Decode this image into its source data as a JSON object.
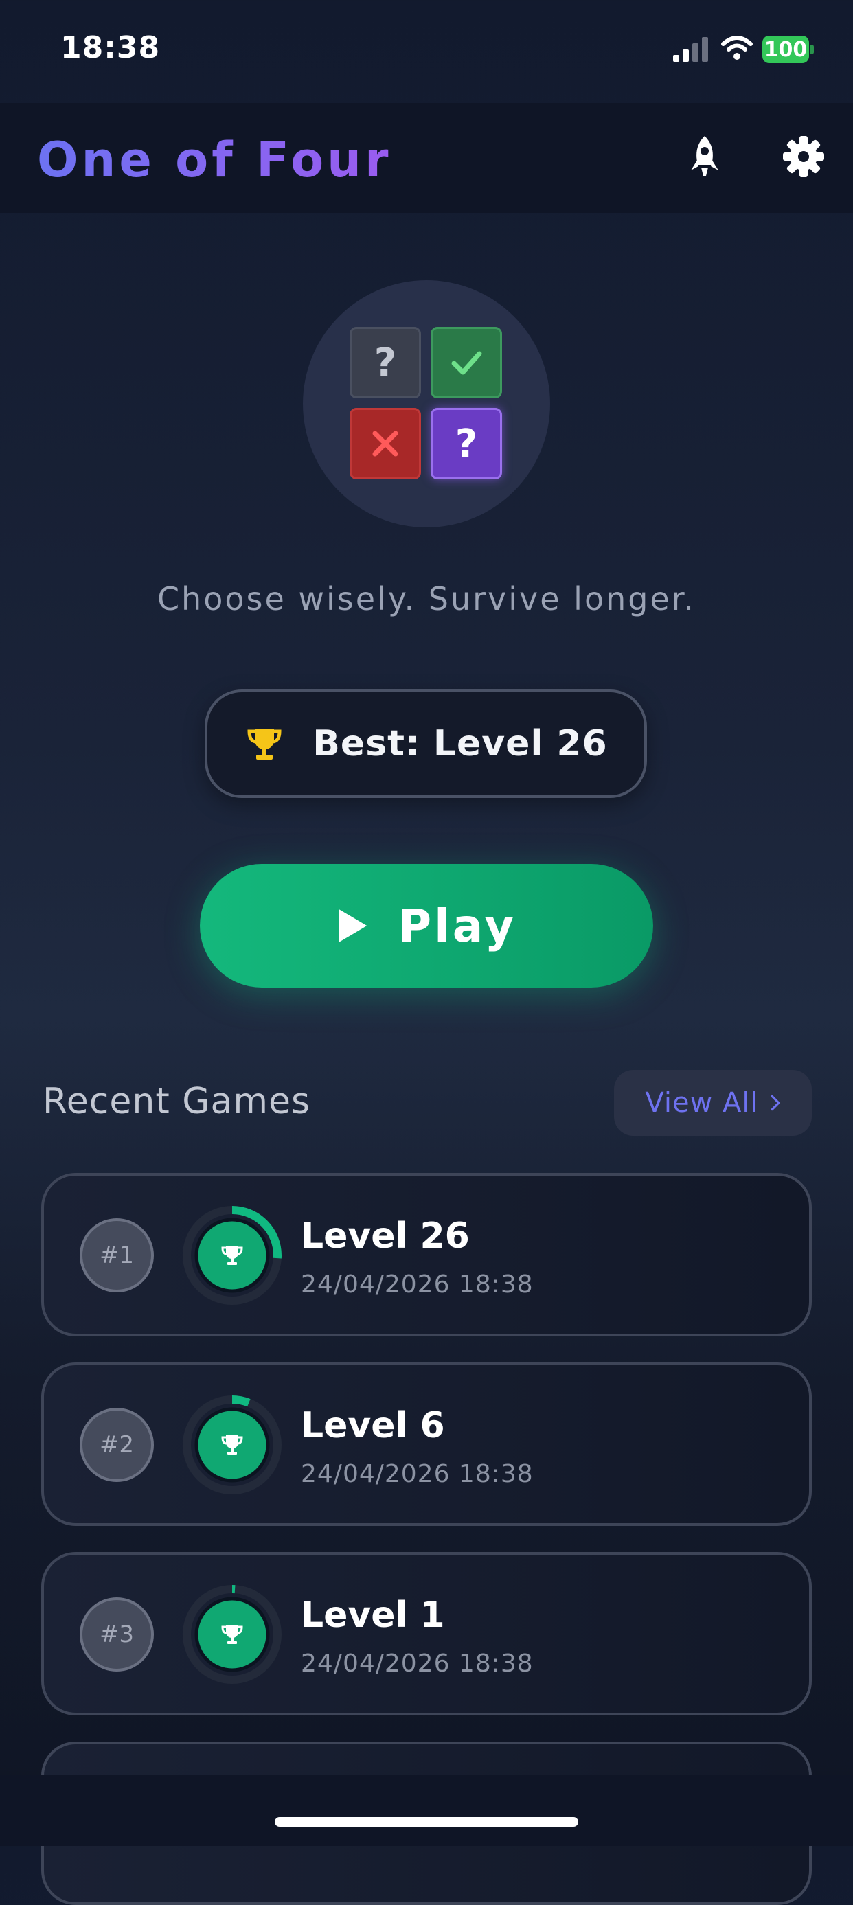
{
  "status_bar": {
    "time": "18:38",
    "battery": "100"
  },
  "header": {
    "title": "One of Four"
  },
  "logo": {
    "tile_1": "?",
    "tile_4": "?"
  },
  "tagline": "Choose wisely. Survive longer.",
  "best": {
    "label": "Best: Level 26"
  },
  "play": {
    "label": "Play"
  },
  "recent": {
    "title": "Recent Games",
    "view_all": "View All",
    "games": [
      {
        "rank": "#1",
        "level": "Level 26",
        "date": "24/04/2026 18:38",
        "progress": 0.26
      },
      {
        "rank": "#2",
        "level": "Level 6",
        "date": "24/04/2026 18:38",
        "progress": 0.06
      },
      {
        "rank": "#3",
        "level": "Level 1",
        "date": "24/04/2026 18:38",
        "progress": 0.01
      }
    ]
  },
  "colors": {
    "accent_green": "#10b981",
    "accent_purple": "#6e72f0",
    "trophy_gold": "#f5c518"
  },
  "icons": [
    "rocket-icon",
    "gear-icon",
    "trophy-icon",
    "play-icon",
    "chevron-right-icon",
    "check-icon",
    "x-icon"
  ]
}
